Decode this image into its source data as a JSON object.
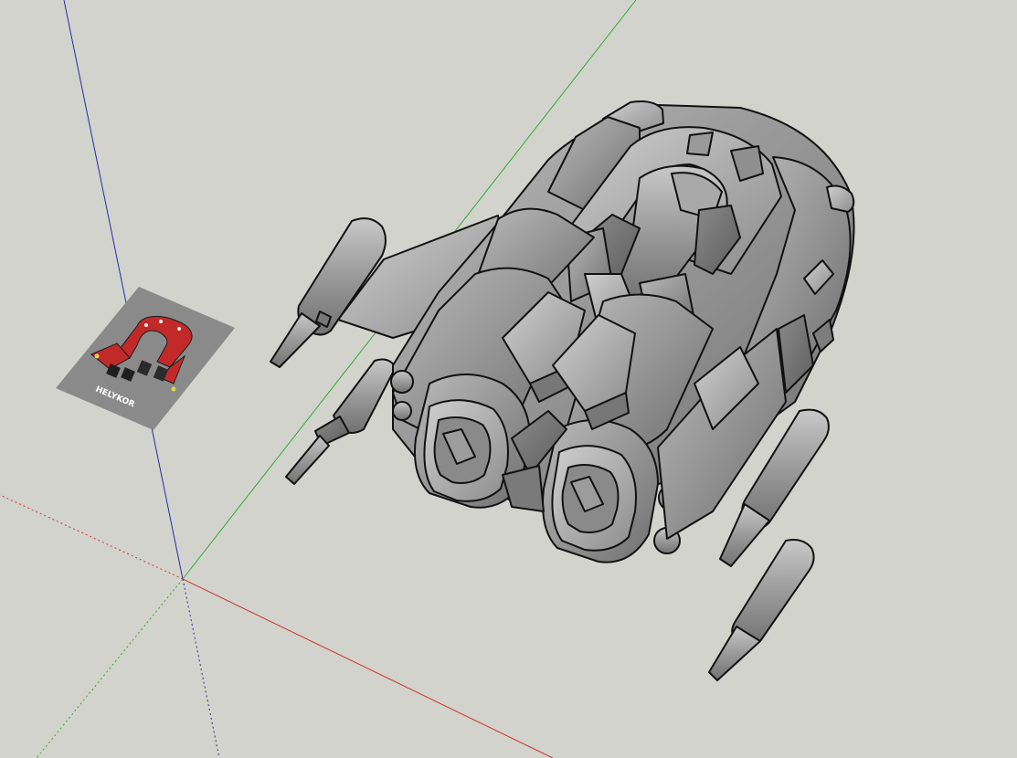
{
  "scene": {
    "background": "#d2d3cc",
    "axis_colors": {
      "x": "#cc3333",
      "y": "#33aa33",
      "z": "#2a2aa8"
    },
    "model_color": "#8f8f8f"
  },
  "reference_image": {
    "caption": "HELYKOR",
    "card_color": "#8a8a8a",
    "ship_color": "#c22a2a"
  }
}
